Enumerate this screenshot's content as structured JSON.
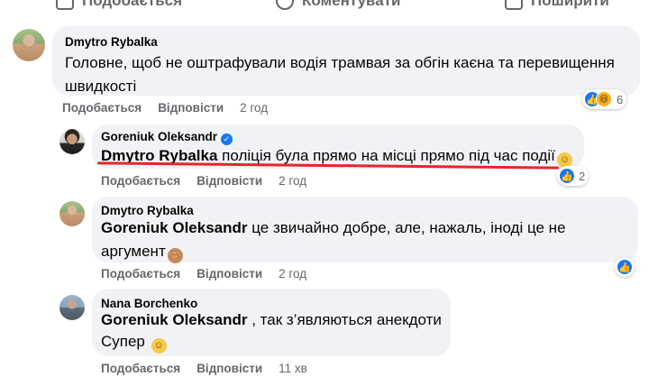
{
  "top_actions": [
    {
      "label": "Подобається",
      "icon": "like-icon"
    },
    {
      "label": "Коментувати",
      "icon": "comment-icon"
    },
    {
      "label": "Поширити",
      "icon": "share-icon"
    }
  ],
  "comments": [
    {
      "author": "Dmytro Rybalka",
      "text": "Головне, щоб не оштрафували водія трамвая за обгін каєна та перевищення швидкості",
      "actions": {
        "like": "Подобається",
        "reply": "Відповісти",
        "time": "2 год"
      },
      "reactions": {
        "count": "6",
        "types": [
          "like",
          "haha"
        ]
      }
    },
    {
      "author": "Goreniuk Oleksandr",
      "verified": true,
      "mention": "Dmytro Rybalka",
      "text": "поліція була прямо на місці прямо під час події",
      "emoji": "hugging-face",
      "actions": {
        "like": "Подобається",
        "reply": "Відповісти",
        "time": "2 год"
      },
      "reactions": {
        "count": "2",
        "types": [
          "like"
        ]
      }
    },
    {
      "author": "Dmytro Rybalka",
      "mention": "Goreniuk Oleksandr",
      "text": "це звичайно добре, але, нажаль, іноді це не аргумент",
      "emoji": "see-no-evil-monkey",
      "actions": {
        "like": "Подобається",
        "reply": "Відповісти",
        "time": "2 год"
      },
      "reactions": {
        "count": "",
        "types": [
          "like"
        ]
      }
    },
    {
      "author": "Nana Borchenko",
      "mention": "Goreniuk Oleksandr",
      "text": ", так з’являються анекдоти",
      "text2": "Супер",
      "emoji": "smiling-face",
      "actions": {
        "like": "Подобається",
        "reply": "Відповісти",
        "time": "11 хв"
      }
    }
  ],
  "colors": {
    "bubble": "#f0f2f5",
    "muted": "#65676b",
    "like_blue": "#1877f2",
    "underline": "#e4262c"
  }
}
